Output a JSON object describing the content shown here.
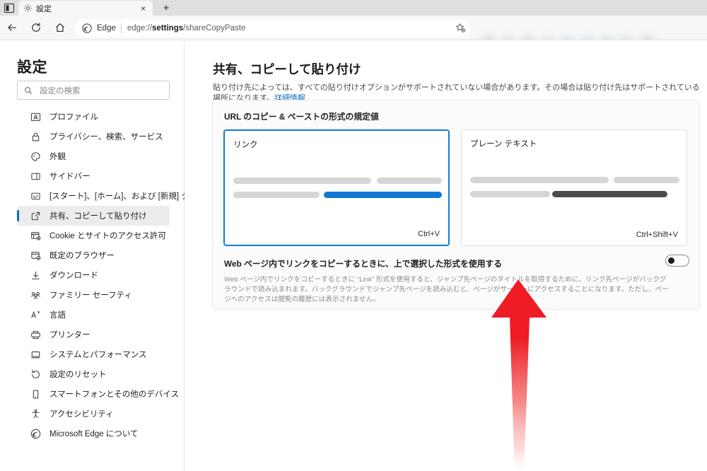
{
  "window": {
    "tab_strip_button": "tab-actions",
    "tab": {
      "title": "設定",
      "favicon": "gear-icon",
      "close": "×"
    },
    "new_tab": "+"
  },
  "toolbar": {
    "back": "←",
    "refresh": "⟳",
    "home": "⌂",
    "omnibox": {
      "site_label": "Edge",
      "url_prefix": "edge://",
      "url_bold": "settings",
      "url_suffix": "/shareCopyPaste",
      "favorite_icon": "star-add-icon"
    }
  },
  "sidebar": {
    "title": "設定",
    "search": {
      "placeholder": "設定の検索",
      "icon": "search-icon"
    },
    "items": [
      {
        "label": "プロファイル",
        "icon": "profile-icon",
        "active": false
      },
      {
        "label": "プライバシー、検索、サービス",
        "icon": "lock-icon",
        "active": false
      },
      {
        "label": "外観",
        "icon": "appearance-icon",
        "active": false
      },
      {
        "label": "サイドバー",
        "icon": "sidebar-icon",
        "active": false
      },
      {
        "label": "[スタート]、[ホーム]、および [新規] タブ",
        "icon": "start-home-tab-icon",
        "active": false
      },
      {
        "label": "共有、コピーして貼り付け",
        "icon": "share-copy-paste-icon",
        "active": true
      },
      {
        "label": "Cookie とサイトのアクセス許可",
        "icon": "cookies-icon",
        "active": false
      },
      {
        "label": "既定のブラウザー",
        "icon": "default-browser-icon",
        "active": false
      },
      {
        "label": "ダウンロード",
        "icon": "download-icon",
        "active": false
      },
      {
        "label": "ファミリー セーフティ",
        "icon": "family-safety-icon",
        "active": false
      },
      {
        "label": "言語",
        "icon": "language-icon",
        "active": false
      },
      {
        "label": "プリンター",
        "icon": "printer-icon",
        "active": false
      },
      {
        "label": "システムとパフォーマンス",
        "icon": "system-performance-icon",
        "active": false
      },
      {
        "label": "設定のリセット",
        "icon": "reset-icon",
        "active": false
      },
      {
        "label": "スマートフォンとその他のデバイス",
        "icon": "phone-icon",
        "active": false
      },
      {
        "label": "アクセシビリティ",
        "icon": "accessibility-icon",
        "active": false
      },
      {
        "label": "Microsoft Edge について",
        "icon": "edge-icon",
        "active": false
      }
    ]
  },
  "main": {
    "heading": "共有、コピーして貼り付け",
    "description": "貼り付け先によっては、すべての貼り付けオプションがサポートされていない場合があります。その場合は貼り付け先はサポートされている場所になります。",
    "description_link": "詳細情報",
    "card": {
      "title": "URL のコピー & ペーストの形式の規定値",
      "tiles": [
        {
          "label": "リンク",
          "shortcut": "Ctrl+V",
          "selected": true,
          "accent": "#0f7cd4"
        },
        {
          "label": "プレーン テキスト",
          "shortcut": "Ctrl+Shift+V",
          "selected": false,
          "accent": "#4a4a4a"
        }
      ],
      "toggle": {
        "title": "Web ページ内でリンクをコピーするときに、上で選択した形式を使用する",
        "description": "Web ページ内でリンクをコピーするときに \"Link\" 形式を使用すると、ジャンプ先ページのタイトルを取得するために、リンク先ページがバックグラウンドで読み込まれます。バックグラウンドでジャンプ先ページを読み込むと、ページがサーバーにアクセスすることになります。ただし、ページへのアクセスは閲覧の履歴には表示されません。",
        "state": "off"
      }
    }
  },
  "annotation": {
    "arrow_color": "#ee1c24",
    "arrow_direction": "up"
  },
  "colors": {
    "accent": "#0f6cbd",
    "tile_selected_border": "#0f7cd4",
    "bar_gray": "#d6d6d6",
    "bar_blue": "#1178d4",
    "bar_dark": "#4c4c4c",
    "chrome_bg": "#f7f7f7",
    "tabstrip_bg": "#dfdfdf"
  }
}
